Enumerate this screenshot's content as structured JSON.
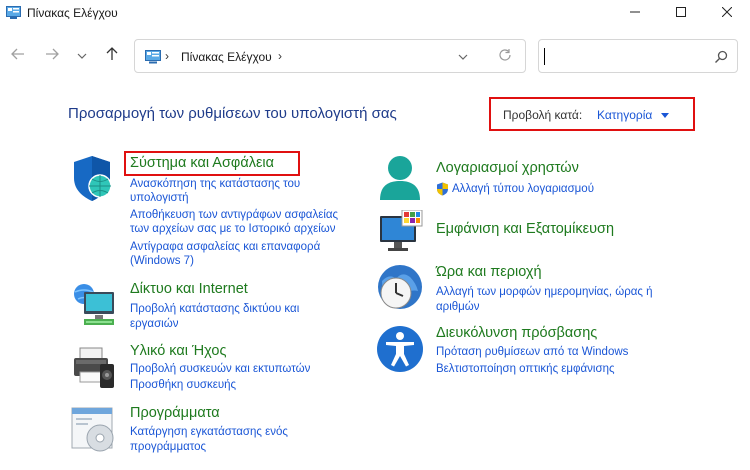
{
  "window": {
    "title": "Πίνακας Ελέγχου"
  },
  "address": {
    "path": "Πίνακας Ελέγχου",
    "search_value": ""
  },
  "header": {
    "title": "Προσαρμογή των ρυθμίσεων του υπολογιστή σας",
    "view_by_label": "Προβολή κατά:",
    "view_by_value": "Κατηγορία"
  },
  "categories_left": [
    {
      "title": "Σύστημα και Ασφάλεια",
      "icon": "shield-icon",
      "links": [
        "Ανασκόπηση της κατάστασης του",
        "υπολογιστή",
        "Αποθήκευση των αντιγράφων ασφαλείας",
        "των αρχείων σας με το Ιστορικό αρχείων",
        "Αντίγραφα ασφαλείας και επαναφορά",
        "(Windows 7)"
      ]
    },
    {
      "title": "Δίκτυο και Internet",
      "icon": "network-icon",
      "links": [
        "Προβολή κατάστασης δικτύου και",
        "εργασιών"
      ]
    },
    {
      "title": "Υλικό και Ήχος",
      "icon": "printer-icon",
      "links": [
        "Προβολή συσκευών και εκτυπωτών",
        "Προσθήκη συσκευής"
      ]
    },
    {
      "title": "Προγράμματα",
      "icon": "programs-icon",
      "links": [
        "Κατάργηση εγκατάστασης ενός",
        "προγράμματος"
      ]
    }
  ],
  "categories_right": [
    {
      "title": "Λογαριασμοί χρηστών",
      "icon": "user-icon",
      "links": [
        "Αλλαγή τύπου λογαριασμού"
      ]
    },
    {
      "title": "Εμφάνιση και Εξατομίκευση",
      "icon": "monitor-icon",
      "links": []
    },
    {
      "title": "Ώρα και περιοχή",
      "icon": "clock-icon",
      "links": [
        "Αλλαγή των μορφών ημερομηνίας, ώρας ή",
        "αριθμών"
      ]
    },
    {
      "title": "Διευκόλυνση πρόσβασης",
      "icon": "accessibility-icon",
      "links": [
        "Πρόταση ρυθμίσεων από τα Windows",
        "Βελτιστοποίηση οπτικής εμφάνισης"
      ]
    }
  ],
  "colors": {
    "title_blue": "#1e3b8a",
    "link_blue": "#1a56d6",
    "category_green": "#1e7a1e",
    "highlight_red": "#e01010"
  }
}
